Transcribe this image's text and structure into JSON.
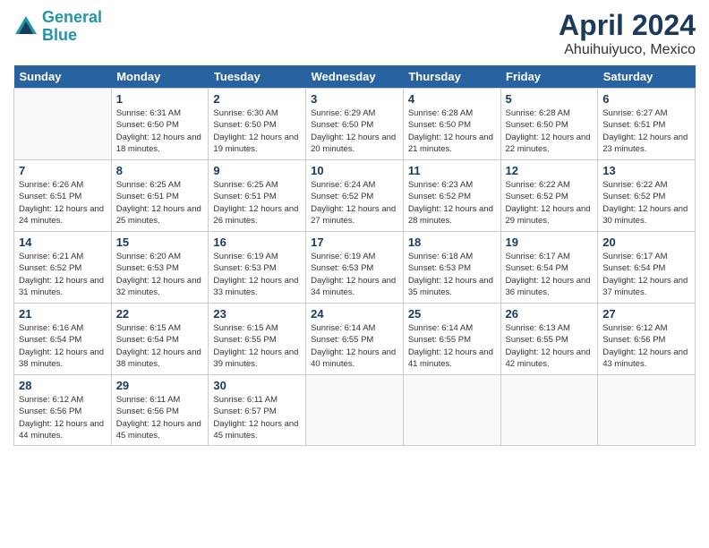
{
  "header": {
    "logo_line1": "General",
    "logo_line2": "Blue",
    "month_title": "April 2024",
    "location": "Ahuihuiyuco, Mexico"
  },
  "weekdays": [
    "Sunday",
    "Monday",
    "Tuesday",
    "Wednesday",
    "Thursday",
    "Friday",
    "Saturday"
  ],
  "weeks": [
    [
      {
        "day": "",
        "sunrise": "",
        "sunset": "",
        "daylight": ""
      },
      {
        "day": "1",
        "sunrise": "Sunrise: 6:31 AM",
        "sunset": "Sunset: 6:50 PM",
        "daylight": "Daylight: 12 hours and 18 minutes."
      },
      {
        "day": "2",
        "sunrise": "Sunrise: 6:30 AM",
        "sunset": "Sunset: 6:50 PM",
        "daylight": "Daylight: 12 hours and 19 minutes."
      },
      {
        "day": "3",
        "sunrise": "Sunrise: 6:29 AM",
        "sunset": "Sunset: 6:50 PM",
        "daylight": "Daylight: 12 hours and 20 minutes."
      },
      {
        "day": "4",
        "sunrise": "Sunrise: 6:28 AM",
        "sunset": "Sunset: 6:50 PM",
        "daylight": "Daylight: 12 hours and 21 minutes."
      },
      {
        "day": "5",
        "sunrise": "Sunrise: 6:28 AM",
        "sunset": "Sunset: 6:50 PM",
        "daylight": "Daylight: 12 hours and 22 minutes."
      },
      {
        "day": "6",
        "sunrise": "Sunrise: 6:27 AM",
        "sunset": "Sunset: 6:51 PM",
        "daylight": "Daylight: 12 hours and 23 minutes."
      }
    ],
    [
      {
        "day": "7",
        "sunrise": "Sunrise: 6:26 AM",
        "sunset": "Sunset: 6:51 PM",
        "daylight": "Daylight: 12 hours and 24 minutes."
      },
      {
        "day": "8",
        "sunrise": "Sunrise: 6:25 AM",
        "sunset": "Sunset: 6:51 PM",
        "daylight": "Daylight: 12 hours and 25 minutes."
      },
      {
        "day": "9",
        "sunrise": "Sunrise: 6:25 AM",
        "sunset": "Sunset: 6:51 PM",
        "daylight": "Daylight: 12 hours and 26 minutes."
      },
      {
        "day": "10",
        "sunrise": "Sunrise: 6:24 AM",
        "sunset": "Sunset: 6:52 PM",
        "daylight": "Daylight: 12 hours and 27 minutes."
      },
      {
        "day": "11",
        "sunrise": "Sunrise: 6:23 AM",
        "sunset": "Sunset: 6:52 PM",
        "daylight": "Daylight: 12 hours and 28 minutes."
      },
      {
        "day": "12",
        "sunrise": "Sunrise: 6:22 AM",
        "sunset": "Sunset: 6:52 PM",
        "daylight": "Daylight: 12 hours and 29 minutes."
      },
      {
        "day": "13",
        "sunrise": "Sunrise: 6:22 AM",
        "sunset": "Sunset: 6:52 PM",
        "daylight": "Daylight: 12 hours and 30 minutes."
      }
    ],
    [
      {
        "day": "14",
        "sunrise": "Sunrise: 6:21 AM",
        "sunset": "Sunset: 6:52 PM",
        "daylight": "Daylight: 12 hours and 31 minutes."
      },
      {
        "day": "15",
        "sunrise": "Sunrise: 6:20 AM",
        "sunset": "Sunset: 6:53 PM",
        "daylight": "Daylight: 12 hours and 32 minutes."
      },
      {
        "day": "16",
        "sunrise": "Sunrise: 6:19 AM",
        "sunset": "Sunset: 6:53 PM",
        "daylight": "Daylight: 12 hours and 33 minutes."
      },
      {
        "day": "17",
        "sunrise": "Sunrise: 6:19 AM",
        "sunset": "Sunset: 6:53 PM",
        "daylight": "Daylight: 12 hours and 34 minutes."
      },
      {
        "day": "18",
        "sunrise": "Sunrise: 6:18 AM",
        "sunset": "Sunset: 6:53 PM",
        "daylight": "Daylight: 12 hours and 35 minutes."
      },
      {
        "day": "19",
        "sunrise": "Sunrise: 6:17 AM",
        "sunset": "Sunset: 6:54 PM",
        "daylight": "Daylight: 12 hours and 36 minutes."
      },
      {
        "day": "20",
        "sunrise": "Sunrise: 6:17 AM",
        "sunset": "Sunset: 6:54 PM",
        "daylight": "Daylight: 12 hours and 37 minutes."
      }
    ],
    [
      {
        "day": "21",
        "sunrise": "Sunrise: 6:16 AM",
        "sunset": "Sunset: 6:54 PM",
        "daylight": "Daylight: 12 hours and 38 minutes."
      },
      {
        "day": "22",
        "sunrise": "Sunrise: 6:15 AM",
        "sunset": "Sunset: 6:54 PM",
        "daylight": "Daylight: 12 hours and 38 minutes."
      },
      {
        "day": "23",
        "sunrise": "Sunrise: 6:15 AM",
        "sunset": "Sunset: 6:55 PM",
        "daylight": "Daylight: 12 hours and 39 minutes."
      },
      {
        "day": "24",
        "sunrise": "Sunrise: 6:14 AM",
        "sunset": "Sunset: 6:55 PM",
        "daylight": "Daylight: 12 hours and 40 minutes."
      },
      {
        "day": "25",
        "sunrise": "Sunrise: 6:14 AM",
        "sunset": "Sunset: 6:55 PM",
        "daylight": "Daylight: 12 hours and 41 minutes."
      },
      {
        "day": "26",
        "sunrise": "Sunrise: 6:13 AM",
        "sunset": "Sunset: 6:55 PM",
        "daylight": "Daylight: 12 hours and 42 minutes."
      },
      {
        "day": "27",
        "sunrise": "Sunrise: 6:12 AM",
        "sunset": "Sunset: 6:56 PM",
        "daylight": "Daylight: 12 hours and 43 minutes."
      }
    ],
    [
      {
        "day": "28",
        "sunrise": "Sunrise: 6:12 AM",
        "sunset": "Sunset: 6:56 PM",
        "daylight": "Daylight: 12 hours and 44 minutes."
      },
      {
        "day": "29",
        "sunrise": "Sunrise: 6:11 AM",
        "sunset": "Sunset: 6:56 PM",
        "daylight": "Daylight: 12 hours and 45 minutes."
      },
      {
        "day": "30",
        "sunrise": "Sunrise: 6:11 AM",
        "sunset": "Sunset: 6:57 PM",
        "daylight": "Daylight: 12 hours and 45 minutes."
      },
      {
        "day": "",
        "sunrise": "",
        "sunset": "",
        "daylight": ""
      },
      {
        "day": "",
        "sunrise": "",
        "sunset": "",
        "daylight": ""
      },
      {
        "day": "",
        "sunrise": "",
        "sunset": "",
        "daylight": ""
      },
      {
        "day": "",
        "sunrise": "",
        "sunset": "",
        "daylight": ""
      }
    ]
  ]
}
